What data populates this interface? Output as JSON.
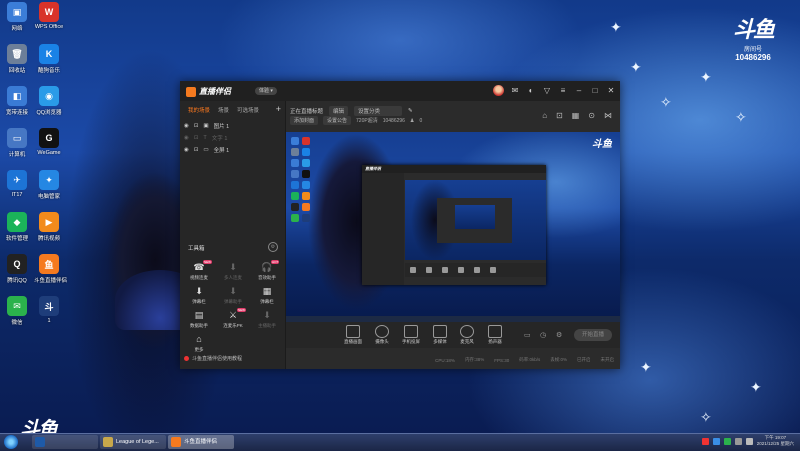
{
  "desktop": {
    "icons": [
      {
        "label": "网络",
        "color": "#3b7dd8",
        "glyph": "▣"
      },
      {
        "label": "WPS Office",
        "color": "#d8332a",
        "glyph": "W"
      },
      {
        "label": "回收站",
        "color": "#6d7f99",
        "glyph": "🗑"
      },
      {
        "label": "酷狗音乐",
        "color": "#1a82e6",
        "glyph": "K"
      },
      {
        "label": "宽带连接",
        "color": "#3a7bd5",
        "glyph": "◧"
      },
      {
        "label": "QQ浏览器",
        "color": "#2a9be8",
        "glyph": "◉"
      },
      {
        "label": "计算机",
        "color": "#4677c4",
        "glyph": "▭"
      },
      {
        "label": "WeGame",
        "color": "#111111",
        "glyph": "G"
      },
      {
        "label": "IT17",
        "color": "#1d74d6",
        "glyph": "✈"
      },
      {
        "label": "电脑管家",
        "color": "#2587e3",
        "glyph": "✦"
      },
      {
        "label": "软件管理",
        "color": "#1bb35a",
        "glyph": "◆"
      },
      {
        "label": "腾讯视频",
        "color": "#f28b1c",
        "glyph": "▶"
      },
      {
        "label": "腾讯QQ",
        "color": "#222222",
        "glyph": "Q"
      },
      {
        "label": "斗鱼直播伴侣",
        "color": "#f57a1f",
        "glyph": "鱼"
      },
      {
        "label": "微信",
        "color": "#2bb24c",
        "glyph": "✉"
      },
      {
        "label": "1",
        "color": "#1e3d7a",
        "glyph": "斗"
      }
    ],
    "logo_mark": "斗鱼",
    "logo_sub": "房间号",
    "room_number": "10486296",
    "watermark": "斗鱼"
  },
  "app": {
    "name": "直播伴侣",
    "version_badge": "体验 ▾",
    "left_tabs": [
      "我的场景",
      "场景",
      "可选场景"
    ],
    "add_symbol": "+",
    "scenes": [
      {
        "name": "图片 1",
        "dim": false
      },
      {
        "name": "文字 1",
        "dim": true
      },
      {
        "name": "全屏 1",
        "dim": false
      }
    ],
    "tools_title": "工具箱",
    "tools": [
      {
        "label": "视频连麦",
        "icon": "☎",
        "badge": "NEW",
        "dim": false
      },
      {
        "label": "多人连麦",
        "icon": "⬇",
        "badge": "",
        "dim": true
      },
      {
        "label": "音效助手",
        "icon": "🎧",
        "badge": "HOT",
        "dim": false
      },
      {
        "label": "弹幕栏",
        "icon": "⬇",
        "badge": "",
        "dim": false
      },
      {
        "label": "弹幕助手",
        "icon": "⬇",
        "badge": "",
        "dim": true
      },
      {
        "label": "弹幕栏",
        "icon": "▦",
        "badge": "",
        "dim": false
      },
      {
        "label": "数据助手",
        "icon": "▤",
        "badge": "",
        "dim": false
      },
      {
        "label": "连麦乐PK",
        "icon": "⚔",
        "badge": "NEW",
        "dim": false
      },
      {
        "label": "主播助手",
        "icon": "⬇",
        "badge": "",
        "dim": true
      },
      {
        "label": "更多",
        "icon": "⌂",
        "badge": "",
        "dim": false
      }
    ],
    "notice": "斗鱼直播伴侣使用教程",
    "room_title_label": "正在直播标题",
    "room_title_chip": "编辑",
    "category_label": "设置分类",
    "resolution": "720P超清",
    "room_id": "10486296",
    "online_count": "0",
    "sub_chips": [
      "添加封面",
      "设置公告"
    ],
    "preview_logo": "斗鱼",
    "controls": [
      {
        "label": "直播画面",
        "icon": "▭"
      },
      {
        "label": "摄像头",
        "icon": "◎"
      },
      {
        "label": "手机投屏",
        "icon": "▯"
      },
      {
        "label": "多媒体",
        "icon": "▶"
      },
      {
        "label": "麦克风",
        "icon": "🎤"
      },
      {
        "label": "扬声器",
        "icon": "🔊"
      }
    ],
    "go_live_label": "开始直播",
    "status_items": [
      "CPU:18%",
      "内存:38%",
      "FPS:30",
      "码率:0kb/s",
      "丢帧:0%",
      "已开启",
      "未开启"
    ]
  },
  "taskbar": {
    "items": [
      {
        "label": "",
        "color": "#1e5aa8"
      },
      {
        "label": "League of Lege...",
        "color": "#c8a84b"
      },
      {
        "label": "斗鱼直播伴侣",
        "color": "#f57a1f"
      }
    ],
    "time": "下午 19:07",
    "date": "2021/12/25 星期六"
  }
}
